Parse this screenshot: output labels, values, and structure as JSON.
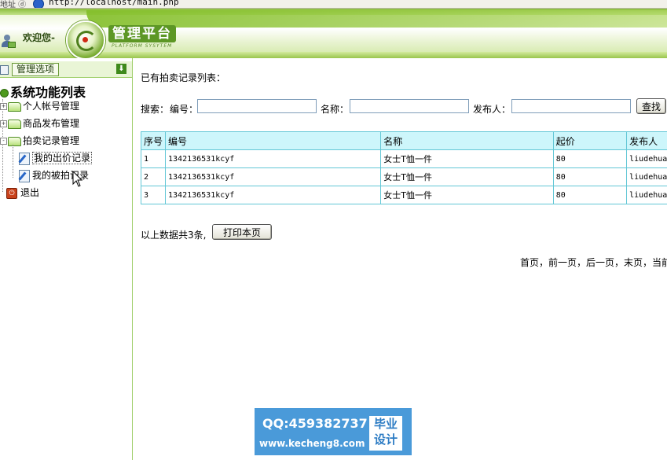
{
  "browser": {
    "address_label": "地址 ⓓ",
    "url": "http://localhost/main.php"
  },
  "header": {
    "welcome": "欢迎您-",
    "platform_title": "管理平台",
    "platform_subtitle": "PLATFORM SYSYTEM"
  },
  "sidebar": {
    "options_label": "管理选项",
    "tree_title": "系统功能列表",
    "items": [
      {
        "label": "个人帐号管理",
        "expander": "+"
      },
      {
        "label": "商品发布管理",
        "expander": "+"
      },
      {
        "label": "拍卖记录管理",
        "expander": "-",
        "children": [
          {
            "label": "我的出价记录"
          },
          {
            "label": "我的被拍记录"
          }
        ]
      }
    ],
    "exit_label": "退出"
  },
  "main": {
    "list_title": "已有拍卖记录列表：",
    "search": {
      "label": "搜索：",
      "field1_label": "编号：",
      "field2_label": "名称：",
      "field3_label": "发布人：",
      "button": "查找"
    },
    "table": {
      "headers": [
        "序号",
        "编号",
        "名称",
        "起价",
        "发布人"
      ],
      "rows": [
        [
          "1",
          "1342136531kcyf",
          "女士T恤一件",
          "80",
          "liudehua"
        ],
        [
          "2",
          "1342136531kcyf",
          "女士T恤一件",
          "80",
          "liudehua"
        ],
        [
          "3",
          "1342136531kcyf",
          "女士T恤一件",
          "80",
          "liudehua"
        ]
      ]
    },
    "total_text": "以上数据共3条,",
    "print_button": "打印本页",
    "pager": "首页，前一页，后一页，末页，当前"
  },
  "watermark": {
    "qq": "QQ:459382737",
    "site": "www.kecheng8.com",
    "badge_line1": "毕业",
    "badge_line2": "设计"
  }
}
